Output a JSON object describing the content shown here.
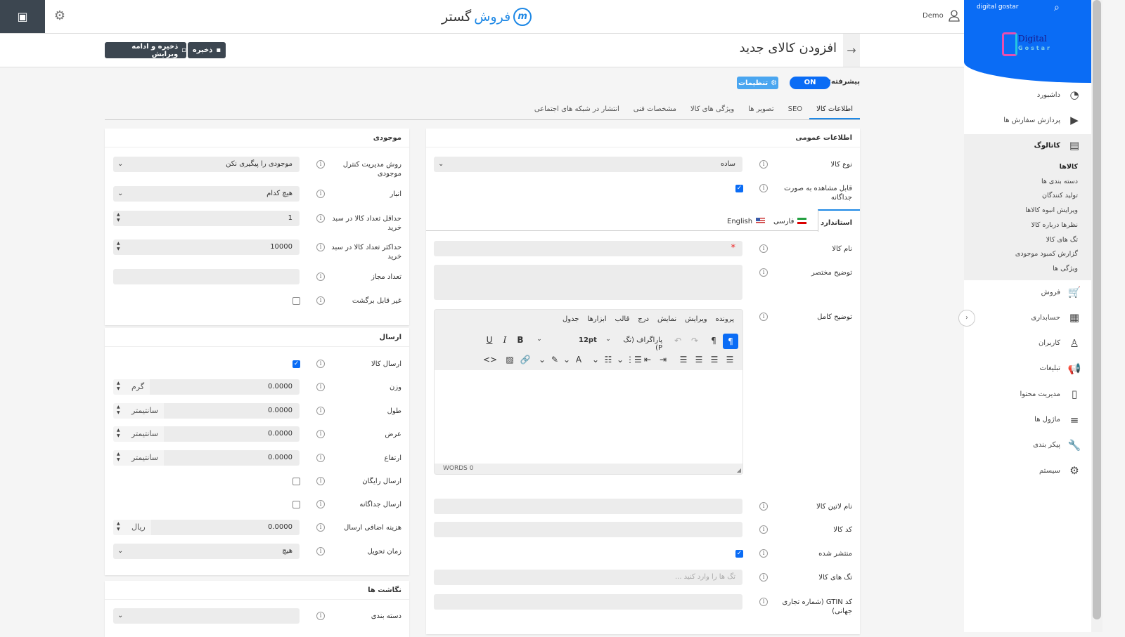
{
  "topbar": {
    "brand_a": "فروش",
    "brand_b": "گستر",
    "user": "Demo"
  },
  "header": {
    "title": "افزودن کالای جدید",
    "save": "ذخیره",
    "save_continue": "ذخیره و ادامه ویرایش"
  },
  "advanced": {
    "label": "پیشرفته:",
    "toggle": "ON",
    "settings": "تنظیمات"
  },
  "tabs": [
    "اطلاعات کالا",
    "SEO",
    "تصویر ها",
    "ویژگی های کالا",
    "مشخصات فنی",
    "انتشار در شبکه های اجتماعی"
  ],
  "general": {
    "title": "اطلاعات عمومی",
    "product_type": {
      "label": "نوع کالا",
      "value": "ساده"
    },
    "visible": {
      "label": "قابل مشاهده به صورت جداگانه",
      "checked": true
    },
    "lang_tabs": [
      "استاندارد",
      "فارسی",
      "English"
    ],
    "name": {
      "label": "نام کالا",
      "required": "*"
    },
    "short_desc": {
      "label": "توضیح مختصر"
    },
    "full_desc": {
      "label": "توضیح کامل"
    },
    "editor": {
      "menu": [
        "پرونده",
        "ویرایش",
        "نمایش",
        "درج",
        "قالب",
        "ابزارها",
        "جدول"
      ],
      "block": "پاراگراف (تگ P)",
      "size": "12pt",
      "words": "WORDS 0"
    },
    "latin_name": {
      "label": "نام لاتین کالا"
    },
    "code": {
      "label": "کد کالا"
    },
    "published": {
      "label": "منتشر شده",
      "checked": true
    },
    "tags": {
      "label": "تگ های کالا",
      "placeholder": "تگ ها را وارد کنید ..."
    },
    "gtin": {
      "label": "کد GTIN (شماره تجاری جهانی)"
    }
  },
  "inventory": {
    "title": "موجودی",
    "rows": [
      {
        "label": "روش مدیریت کنترل موجودی",
        "type": "select",
        "value": "موجودی را پیگیری نکن"
      },
      {
        "label": "انبار",
        "type": "select",
        "value": "هیچ کدام"
      },
      {
        "label": "حداقل تعداد کالا در سبد خرید",
        "type": "number",
        "value": "1"
      },
      {
        "label": "حداکثر تعداد کالا در سبد خرید",
        "type": "number",
        "value": "10000"
      },
      {
        "label": "تعداد مجاز",
        "type": "text",
        "value": ""
      },
      {
        "label": "غیر قابل برگشت",
        "type": "checkbox",
        "checked": false
      }
    ]
  },
  "shipping": {
    "title": "ارسال",
    "rows": [
      {
        "label": "ارسال کالا",
        "type": "checkbox",
        "checked": true
      },
      {
        "label": "وزن",
        "type": "unit",
        "value": "0.0000",
        "unit": "گرم"
      },
      {
        "label": "طول",
        "type": "unit",
        "value": "0.0000",
        "unit": "سانتیمتر"
      },
      {
        "label": "عرض",
        "type": "unit",
        "value": "0.0000",
        "unit": "سانتیمتر"
      },
      {
        "label": "ارتفاع",
        "type": "unit",
        "value": "0.0000",
        "unit": "سانتیمتر"
      },
      {
        "label": "ارسال رایگان",
        "type": "checkbox",
        "checked": false
      },
      {
        "label": "ارسال جداگانه",
        "type": "checkbox",
        "checked": false
      },
      {
        "label": "هزینه اضافی ارسال",
        "type": "unit",
        "value": "0.0000",
        "unit": "ریال"
      },
      {
        "label": "زمان تحویل",
        "type": "select",
        "value": "هیچ"
      }
    ]
  },
  "mapping": {
    "title": "نگاشت ها",
    "rows": [
      {
        "label": "دسته بندی",
        "type": "select",
        "value": ""
      }
    ]
  },
  "sidebar": {
    "site": "digital gostar",
    "logo": "Digital Gostar",
    "items": [
      {
        "label": "داشبورد",
        "icon": "dashboard-icon"
      },
      {
        "label": "پردازش سفارش ها",
        "icon": "play-icon"
      },
      {
        "label": "کاتالوگ",
        "icon": "book-icon"
      }
    ],
    "catalog_sub": [
      "کالاها",
      "دسته بندی ها",
      "تولید کنندگان",
      "ویرایش انبوه کالاها",
      "نظرها درباره کالا",
      "تگ های کالا",
      "گزارش کمبود موجودی",
      "ویژگی ها"
    ],
    "items2": [
      {
        "label": "فروش",
        "icon": "cart-icon"
      },
      {
        "label": "حسابداری",
        "icon": "calculator-icon"
      },
      {
        "label": "کاربران",
        "icon": "user-icon"
      },
      {
        "label": "تبلیغات",
        "icon": "megaphone-icon"
      },
      {
        "label": "مدیریت محتوا",
        "icon": "document-icon"
      },
      {
        "label": "ماژول ها",
        "icon": "menu-icon"
      },
      {
        "label": "پیکر بندی",
        "icon": "wrench-icon"
      },
      {
        "label": "سیستم",
        "icon": "gears-icon"
      }
    ]
  },
  "colors": {
    "accent": "#0a6cf5",
    "dark": "#3c4650"
  }
}
